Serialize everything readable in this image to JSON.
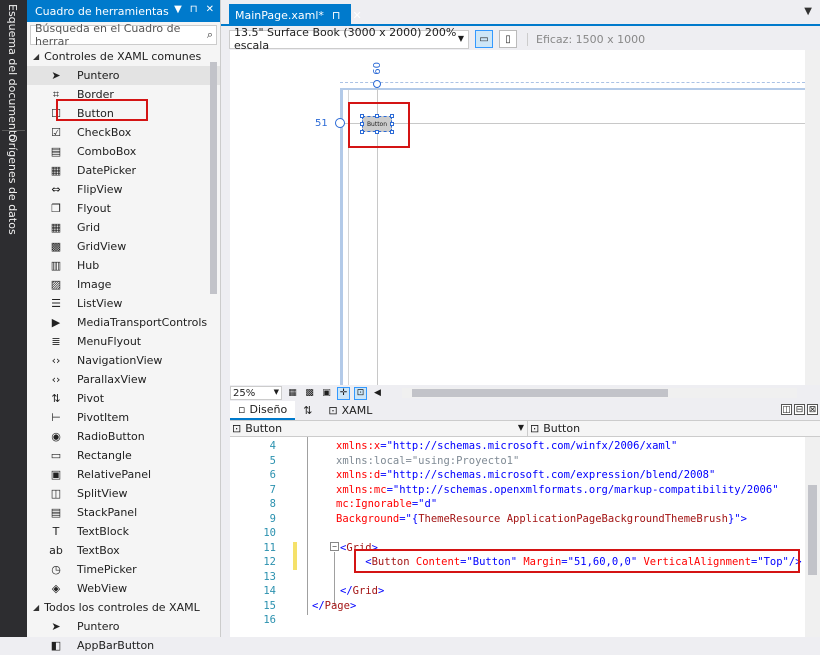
{
  "side_tabs": [
    "Esquema del documento",
    "Orígenes de datos"
  ],
  "toolbox": {
    "title": "Cuadro de herramientas",
    "title_controls": [
      "▼",
      "⊓",
      "✕"
    ],
    "search_placeholder": "Búsqueda en el Cuadro de herrar",
    "groups": [
      {
        "name": "Controles de XAML comunes",
        "items": [
          {
            "label": "Puntero",
            "icon": "pointer-icon"
          },
          {
            "label": "Border",
            "icon": "border-icon"
          },
          {
            "label": "Button",
            "icon": "button-icon"
          },
          {
            "label": "CheckBox",
            "icon": "checkbox-icon"
          },
          {
            "label": "ComboBox",
            "icon": "combobox-icon"
          },
          {
            "label": "DatePicker",
            "icon": "datepicker-icon"
          },
          {
            "label": "FlipView",
            "icon": "flipview-icon"
          },
          {
            "label": "Flyout",
            "icon": "flyout-icon"
          },
          {
            "label": "Grid",
            "icon": "grid-icon"
          },
          {
            "label": "GridView",
            "icon": "gridview-icon"
          },
          {
            "label": "Hub",
            "icon": "hub-icon"
          },
          {
            "label": "Image",
            "icon": "image-icon"
          },
          {
            "label": "ListView",
            "icon": "listview-icon"
          },
          {
            "label": "MediaTransportControls",
            "icon": "media-controls-icon"
          },
          {
            "label": "MenuFlyout",
            "icon": "menuflyout-icon"
          },
          {
            "label": "NavigationView",
            "icon": "navigationview-icon"
          },
          {
            "label": "ParallaxView",
            "icon": "parallaxview-icon"
          },
          {
            "label": "Pivot",
            "icon": "pivot-icon"
          },
          {
            "label": "PivotItem",
            "icon": "pivotitem-icon"
          },
          {
            "label": "RadioButton",
            "icon": "radiobutton-icon"
          },
          {
            "label": "Rectangle",
            "icon": "rectangle-icon"
          },
          {
            "label": "RelativePanel",
            "icon": "relativepanel-icon"
          },
          {
            "label": "SplitView",
            "icon": "splitview-icon"
          },
          {
            "label": "StackPanel",
            "icon": "stackpanel-icon"
          },
          {
            "label": "TextBlock",
            "icon": "textblock-icon"
          },
          {
            "label": "TextBox",
            "icon": "textbox-icon"
          },
          {
            "label": "TimePicker",
            "icon": "timepicker-icon"
          },
          {
            "label": "WebView",
            "icon": "webview-icon"
          }
        ]
      },
      {
        "name": "Todos los controles de XAML",
        "items": [
          {
            "label": "Puntero",
            "icon": "pointer-icon"
          },
          {
            "label": "AppBarButton",
            "icon": "appbarbutton-icon"
          }
        ]
      }
    ]
  },
  "document": {
    "tab_label": "MainPage.xaml*",
    "pin": "⊓",
    "close": "✕"
  },
  "designer_toolbar": {
    "device": "13.5\" Surface Book (3000 x 2000) 200% escala",
    "effective_size": "Eficaz: 1500 x 1000"
  },
  "canvas": {
    "margin_top": "60",
    "margin_left": "51",
    "button_text": "Button"
  },
  "zoom": "25%",
  "split_tabs": {
    "design": "Diseño",
    "swap": "⇅",
    "xaml": "XAML"
  },
  "navbar": {
    "left": "Button",
    "right": "Button"
  },
  "code_lines": [
    {
      "num": "4",
      "tokens": [
        {
          "t": "xmlns:x",
          "c": "attr"
        },
        {
          "t": "=\"http://schemas.microsoft.com/winfx/2006/xaml\"",
          "c": "val"
        }
      ]
    },
    {
      "num": "5",
      "tokens": [
        {
          "t": "xmlns:local=\"using:Proyecto1\"",
          "c": "gray"
        }
      ]
    },
    {
      "num": "6",
      "tokens": [
        {
          "t": "xmlns:d",
          "c": "attr"
        },
        {
          "t": "=\"http://schemas.microsoft.com/expression/blend/2008\"",
          "c": "val"
        }
      ]
    },
    {
      "num": "7",
      "tokens": [
        {
          "t": "xmlns:mc",
          "c": "attr"
        },
        {
          "t": "=\"http://schemas.openxmlformats.org/markup-compatibility/2006\"",
          "c": "val"
        }
      ]
    },
    {
      "num": "8",
      "tokens": [
        {
          "t": "mc:Ignorable",
          "c": "attr"
        },
        {
          "t": "=\"d\"",
          "c": "val"
        }
      ]
    },
    {
      "num": "9",
      "tokens": [
        {
          "t": "Background",
          "c": "attr"
        },
        {
          "t": "=\"{",
          "c": "val"
        },
        {
          "t": "ThemeResource ApplicationPageBackgroundThemeBrush",
          "c": "tag"
        },
        {
          "t": "}\">",
          "c": "val"
        }
      ]
    },
    {
      "num": "10",
      "tokens": []
    },
    {
      "num": "11",
      "tokens": [
        {
          "t": "<",
          "c": "pun"
        },
        {
          "t": "Grid",
          "c": "tag"
        },
        {
          "t": ">",
          "c": "pun"
        }
      ]
    },
    {
      "num": "12",
      "tokens": [
        {
          "t": "    <",
          "c": "pun"
        },
        {
          "t": "Button",
          "c": "tag"
        },
        {
          "t": " Content",
          "c": "attr"
        },
        {
          "t": "=\"Button\"",
          "c": "val"
        },
        {
          "t": " Margin",
          "c": "attr"
        },
        {
          "t": "=\"51,60,0,0\"",
          "c": "val"
        },
        {
          "t": " VerticalAlignment",
          "c": "attr"
        },
        {
          "t": "=\"Top\"/>",
          "c": "val"
        }
      ]
    },
    {
      "num": "13",
      "tokens": []
    },
    {
      "num": "14",
      "tokens": [
        {
          "t": "</",
          "c": "pun"
        },
        {
          "t": "Grid",
          "c": "tag"
        },
        {
          "t": ">",
          "c": "pun"
        }
      ]
    },
    {
      "num": "15",
      "tokens": [
        {
          "t": "</",
          "c": "pun"
        },
        {
          "t": "Page",
          "c": "tag"
        },
        {
          "t": ">",
          "c": "pun"
        }
      ]
    },
    {
      "num": "16",
      "tokens": []
    }
  ],
  "colors": {
    "accent": "#007acc",
    "highlight_box": "#d41414",
    "line_numbers": "#2b91af"
  }
}
